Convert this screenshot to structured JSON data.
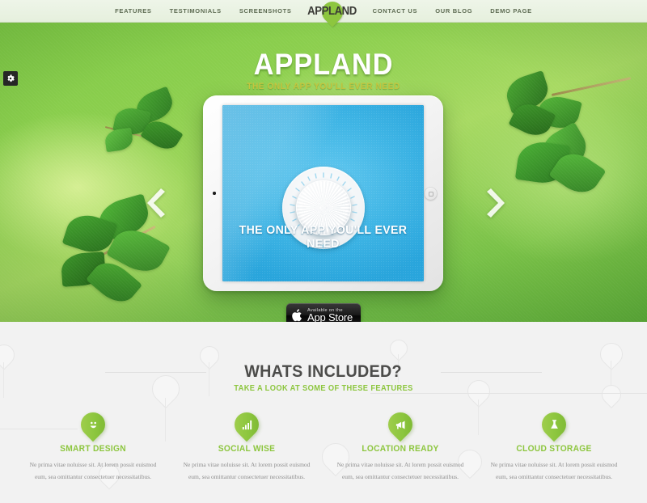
{
  "nav": {
    "left_links": [
      {
        "label": "FEATURES",
        "name": "nav-features"
      },
      {
        "label": "TESTIMONIALS",
        "name": "nav-testimonials"
      },
      {
        "label": "SCREENSHOTS",
        "name": "nav-screenshots"
      }
    ],
    "right_links": [
      {
        "label": "CONTACT US",
        "name": "nav-contact-us"
      },
      {
        "label": "OUR BLOG",
        "name": "nav-our-blog"
      },
      {
        "label": "DEMO PAGE",
        "name": "nav-demo-page"
      }
    ],
    "logo": "APPLAND"
  },
  "hero": {
    "title": "APPLAND",
    "subtitle": "THE ONLY APP YOU'LL EVER NEED",
    "screen_caption": "THE ONLY APP YOU'LL EVER NEED",
    "prev_arrow_icon": "chevron-left-icon",
    "next_arrow_icon": "chevron-right-icon",
    "settings_icon": "gear-icon",
    "appstore": {
      "small_line": "Available on the",
      "big_line": "App Store",
      "apple_glyph": ""
    }
  },
  "features": {
    "title": "WHATS INCLUDED?",
    "subtitle": "TAKE A LOOK AT SOME OF THESE FEATURES",
    "items": [
      {
        "title": "SMART DESIGN",
        "icon": "smiley-face-icon",
        "body": "Ne prima vitae noluisse sit. At lorem possit euismod eum, sea omittantur consectetuer necessitatibus."
      },
      {
        "title": "SOCIAL WISE",
        "icon": "bar-chart-icon",
        "body": "Ne prima vitae noluisse sit. At lorem possit euismod eum, sea omittantur consectetuer necessitatibus."
      },
      {
        "title": "LOCATION READY",
        "icon": "megaphone-icon",
        "body": "Ne prima vitae noluisse sit. At lorem possit euismod eum, sea omittantur consectetuer necessitatibus."
      },
      {
        "title": "CLOUD STORAGE",
        "icon": "flask-icon",
        "body": "Ne prima vitae noluisse sit. At lorem possit euismod eum, sea omittantur consectetuer necessitatibus."
      }
    ]
  },
  "colors": {
    "brand_green": "#8dc63f",
    "hero_green": "#7ec845",
    "screen_blue": "#3fb5e5",
    "nav_bg": "#e9f2e4",
    "section_bg": "#f2f2f2",
    "heading_dark": "#4c4c4a",
    "body_text": "#8f8f8f",
    "hero_subtitle": "#c7c740"
  }
}
